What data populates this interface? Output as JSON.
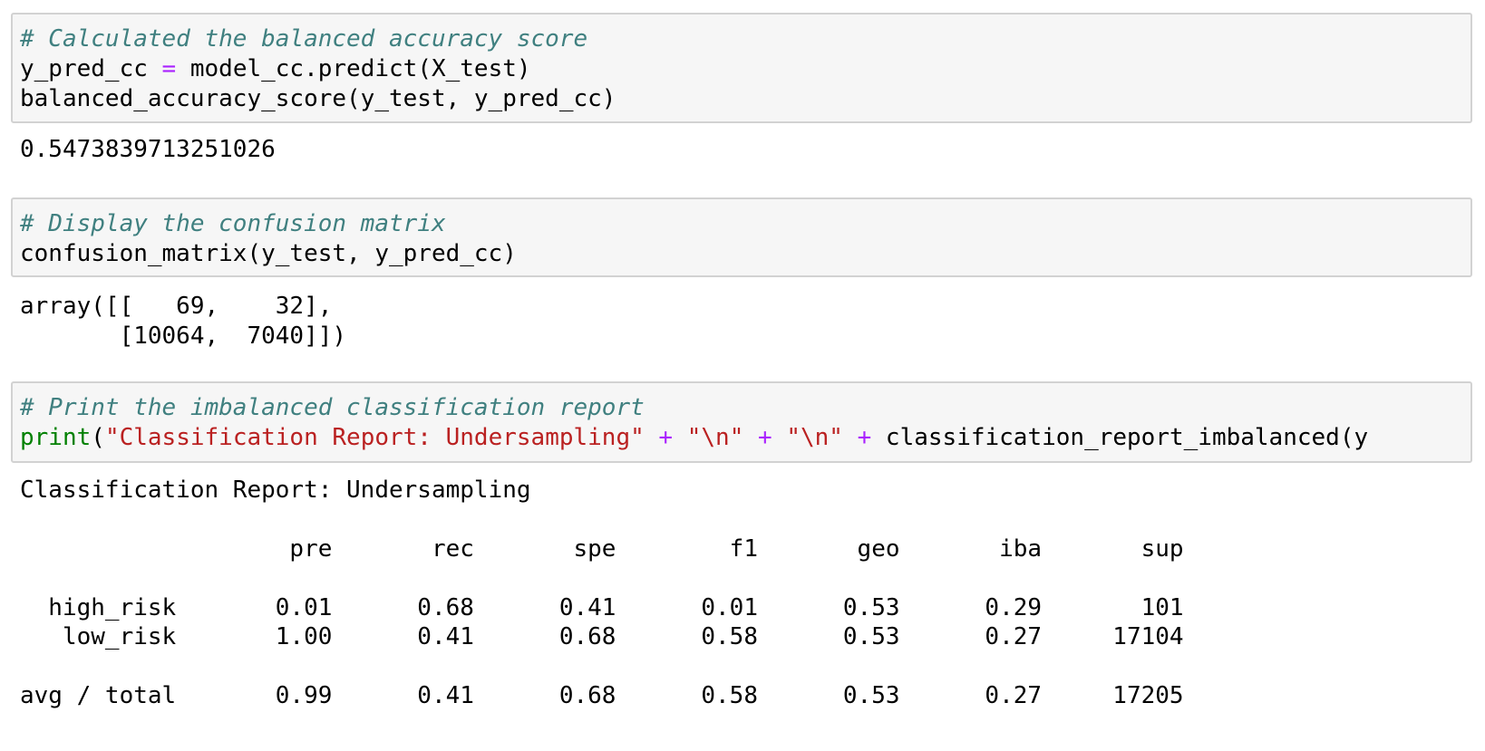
{
  "cells": [
    {
      "code": {
        "comment": "# Calculated the balanced accuracy score",
        "line2_var": "y_pred_cc",
        "line2_eq": "=",
        "line2_rest": "model_cc.predict(X_test)",
        "line3": "balanced_accuracy_score(y_test, y_pred_cc)"
      },
      "output": "0.5473839713251026"
    },
    {
      "code": {
        "comment": "# Display the confusion matrix",
        "line2": "confusion_matrix(y_test, y_pred_cc)"
      },
      "output": {
        "line1": "array([[   69,    32],",
        "line2": "       [10064,  7040]])"
      }
    },
    {
      "code": {
        "comment": "# Print the imbalanced classification report",
        "print_kw": "print",
        "paren_open": "(",
        "str1": "\"Classification Report: Undersampling\"",
        "plus1": "+",
        "str2": "\"\\n\"",
        "plus2": "+",
        "str3": "\"\\n\"",
        "plus3": "+",
        "rest": "classification_report_imbalanced(y"
      },
      "output": {
        "title": "Classification Report: Undersampling",
        "header": "                   pre       rec       spe        f1       geo       iba       sup",
        "row1": "  high_risk       0.01      0.68      0.41      0.01      0.53      0.29       101",
        "row2": "   low_risk       1.00      0.41      0.68      0.58      0.53      0.27     17104",
        "total": "avg / total       0.99      0.41      0.68      0.58      0.53      0.27     17205"
      }
    }
  ]
}
